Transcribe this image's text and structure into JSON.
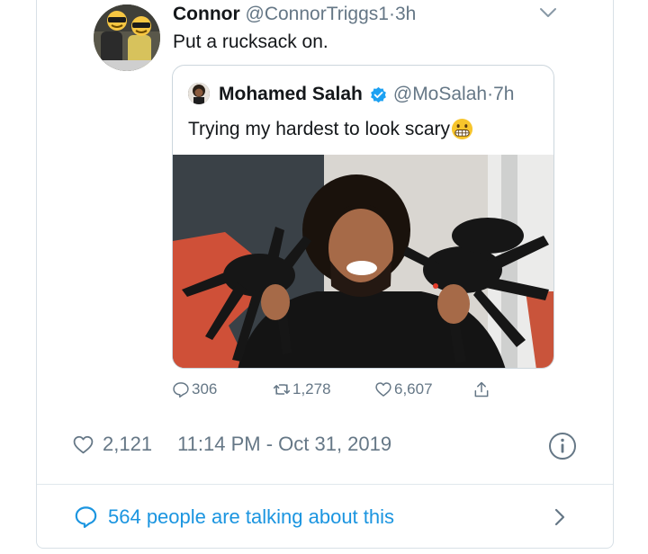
{
  "reply": {
    "name": "Connor",
    "handle": "@ConnorTriggs1",
    "separator": "·",
    "time": "3h",
    "text": "Put a rucksack on."
  },
  "quoted": {
    "name": "Mohamed Salah",
    "handle": "@MoSalah",
    "separator": "·",
    "time": "7h",
    "text": "Trying my hardest to look scary",
    "emoji": "grimacing-face-emoji",
    "actions": {
      "replies": "306",
      "retweets": "1,278",
      "likes": "6,607"
    }
  },
  "meta": {
    "likes": "2,121",
    "timestamp": "11:14 PM - Oct 31, 2019"
  },
  "talking": {
    "text": "564 people are talking about this"
  },
  "colors": {
    "link": "#1b95e0",
    "muted": "#657786",
    "text": "#14171a",
    "verified": "#1da1f2"
  },
  "icons": [
    "chevron-down-icon",
    "verified-badge-icon",
    "reply-icon",
    "retweet-icon",
    "heart-icon",
    "share-icon",
    "info-icon",
    "speech-bubble-icon",
    "chevron-right-icon"
  ]
}
